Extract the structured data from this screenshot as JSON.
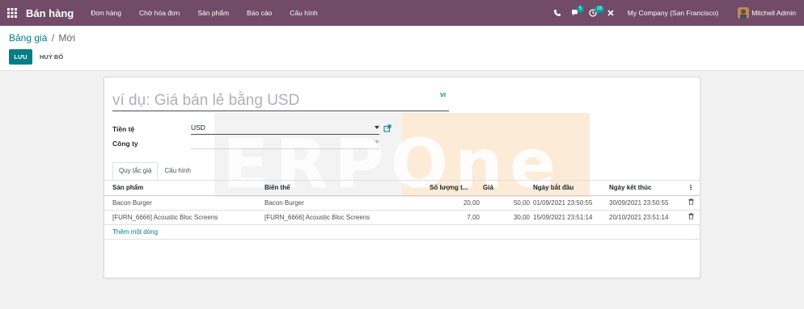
{
  "navbar": {
    "app_title": "Bán hàng",
    "menu": [
      "Đơn hàng",
      "Chờ hóa đơn",
      "Sản phẩm",
      "Báo cáo",
      "Cấu hình"
    ],
    "messages_badge": "5",
    "activities_badge": "28",
    "company": "My Company (San Francisco)",
    "user": "Mitchell Admin",
    "color": "#714b67"
  },
  "breadcrumb": {
    "parent": "Bảng giá",
    "separator": "/",
    "current": "Mới"
  },
  "buttons": {
    "save": "LƯU",
    "discard": "HUỶ BỎ"
  },
  "form": {
    "name_placeholder": "ví dụ: Giá bán lẻ bằng USD",
    "lang": "VI",
    "currency_label": "Tiền tệ",
    "currency_value": "USD",
    "company_label": "Công ty",
    "company_value": ""
  },
  "watermark": "ERPOne",
  "tabs": [
    "Quy tắc giá",
    "Cấu hình"
  ],
  "table": {
    "headers": [
      "Sản phẩm",
      "Biến thể",
      "Số lượng t...",
      "Giá",
      "Ngày bắt đầu",
      "Ngày kết thúc"
    ],
    "rows": [
      [
        "Bacon Burger",
        "Bacon Burger",
        "20,00",
        "50,00",
        "01/09/2021 23:50:55",
        "30/09/2021 23:50:55"
      ],
      [
        "[FURN_6666] Acoustic Bloc Screens",
        "[FURN_6666] Acoustic Bloc Screens",
        "7,00",
        "30,00",
        "15/09/2021 23:51:14",
        "20/10/2021 23:51:14"
      ]
    ],
    "add_line": "Thêm một dòng"
  },
  "accent": "#017e84"
}
